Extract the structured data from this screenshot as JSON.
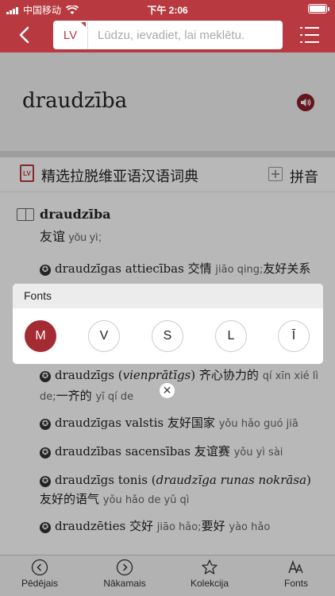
{
  "status_bar": {
    "carrier": "中国移动",
    "time": "下午 2:06"
  },
  "search": {
    "lang_label": "LV",
    "placeholder": "Lūdzu, ievadiet, lai meklētu."
  },
  "word": {
    "headword": "draudzība"
  },
  "dictionary": {
    "title": "精选拉脱维亚语汉语词典",
    "pinyin_label": "拼音"
  },
  "entry": {
    "headword": "draudzība",
    "gloss_zh": "友谊",
    "gloss_pinyin": "yǒu yì;",
    "examples": [
      {
        "lv": "draudzīgas attiecības",
        "zh": "交情",
        "pinyin": "jiāo qing;",
        "zh2": "友好关系",
        "pinyin2": ""
      },
      {
        "lv_a": "draudzīgs (",
        "lv_it": "vienprātīgs",
        "lv_b": ")",
        "zh": "齐心协力的",
        "pinyin": "qí xīn xié lì de;",
        "zh2": "一齐的",
        "pinyin2": "yī qí de"
      },
      {
        "lv": "draudzīgas valstis",
        "zh": "友好国家",
        "pinyin": "yǒu hǎo guó jiā"
      },
      {
        "lv": "draudzības sacensības",
        "zh": "友谊赛",
        "pinyin": "yǒu yì sài"
      },
      {
        "lv_a": "draudzīgs tonis (",
        "lv_it": "draudzīga runas nokrāsa",
        "lv_b": ")",
        "zh": "友好的语气",
        "pinyin": "yǒu hǎo de yǔ qì"
      },
      {
        "lv": "draudzēties",
        "zh": "交好",
        "pinyin": "jiāo hǎo;",
        "zh2": "要好",
        "pinyin2": "yào hǎo"
      }
    ]
  },
  "popup": {
    "title": "Fonts",
    "options": [
      {
        "label": "M",
        "active": true
      },
      {
        "label": "V",
        "active": false
      },
      {
        "label": "S",
        "active": false
      },
      {
        "label": "L",
        "active": false
      },
      {
        "label": "Ī",
        "active": false
      }
    ]
  },
  "tabs": [
    {
      "label": "Pēdējais",
      "icon": "circle-left-icon"
    },
    {
      "label": "Nākamais",
      "icon": "circle-right-icon"
    },
    {
      "label": "Kolekcija",
      "icon": "star-outline-icon"
    },
    {
      "label": "Fonts",
      "icon": "font-size-icon"
    }
  ],
  "colors": {
    "brand": "#b83a40",
    "active_option": "#a52b33"
  }
}
